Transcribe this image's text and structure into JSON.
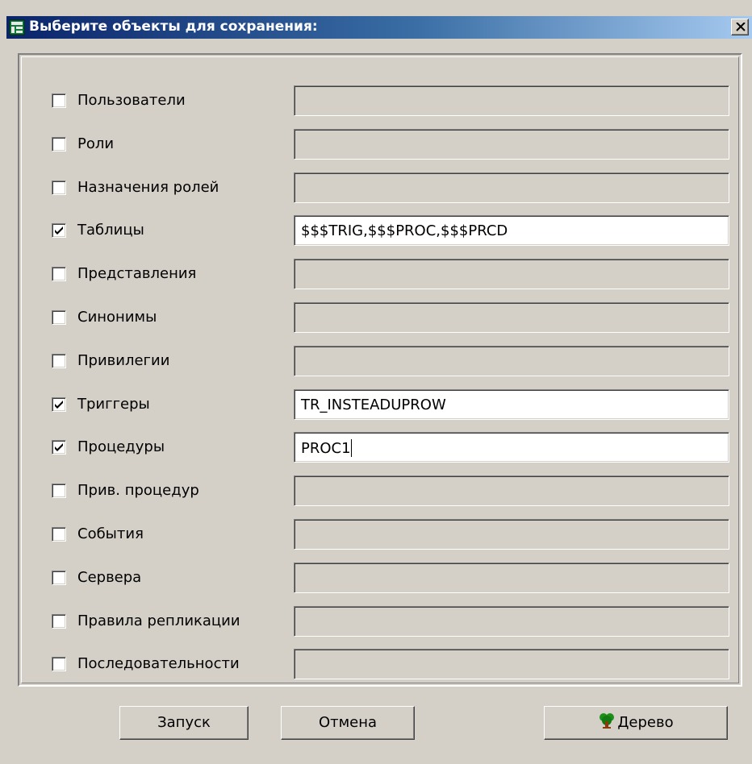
{
  "window": {
    "title": "Выберите объекты для сохранения:",
    "close_symbol": "✕"
  },
  "rows": [
    {
      "label": "Пользователи",
      "checked": false,
      "value": ""
    },
    {
      "label": "Роли",
      "checked": false,
      "value": ""
    },
    {
      "label": "Назначения ролей",
      "checked": false,
      "value": ""
    },
    {
      "label": "Таблицы",
      "checked": true,
      "value": "$$$TRIG,$$$PROC,$$$PRCD"
    },
    {
      "label": "Представления",
      "checked": false,
      "value": ""
    },
    {
      "label": "Синонимы",
      "checked": false,
      "value": ""
    },
    {
      "label": "Привилегии",
      "checked": false,
      "value": ""
    },
    {
      "label": "Триггеры",
      "checked": true,
      "value": "TR_INSTEADUPROW"
    },
    {
      "label": "Процедуры",
      "checked": true,
      "value": "PROC1"
    },
    {
      "label": "Прив. процедур",
      "checked": false,
      "value": ""
    },
    {
      "label": "События",
      "checked": false,
      "value": ""
    },
    {
      "label": "Сервера",
      "checked": false,
      "value": ""
    },
    {
      "label": "Правила репликации",
      "checked": false,
      "value": ""
    },
    {
      "label": "Последовательности",
      "checked": false,
      "value": ""
    }
  ],
  "buttons": {
    "run": "Запуск",
    "cancel": "Отмена",
    "tree": "Дерево",
    "tree_icon": "tree-icon"
  },
  "focused_row": 8
}
